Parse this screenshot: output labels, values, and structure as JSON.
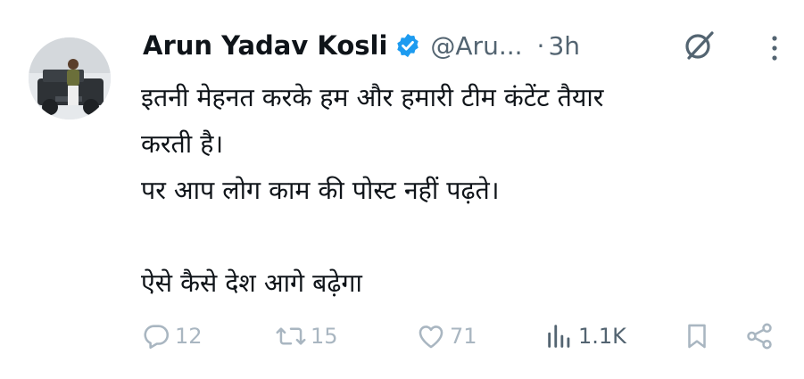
{
  "tweet": {
    "author_name": "Arun Yadav Kosli",
    "handle": "@Aru...",
    "separator": "·",
    "time": "3h",
    "lines": [
      "इतनी मेहनत करके हम और हमारी टीम कंटेंट तैयार",
      "करती है।",
      "पर आप लोग काम की पोस्ट नहीं पढ़ते।",
      "",
      "ऐसे कैसे देश आगे बढ़ेगा"
    ]
  },
  "actions": {
    "replies": "12",
    "reposts": "15",
    "likes": "71",
    "views": "1.1K"
  },
  "colors": {
    "verified": "#1d9bf0",
    "secondary_text": "#536471",
    "action_icon": "#a9b6c1"
  },
  "icons": {
    "verified": "verified-badge-icon",
    "grok": "grok-icon",
    "more": "more-options-icon",
    "reply": "reply-icon",
    "repost": "repost-icon",
    "like": "heart-icon",
    "views": "views-chart-icon",
    "bookmark": "bookmark-icon",
    "share": "share-icon"
  }
}
